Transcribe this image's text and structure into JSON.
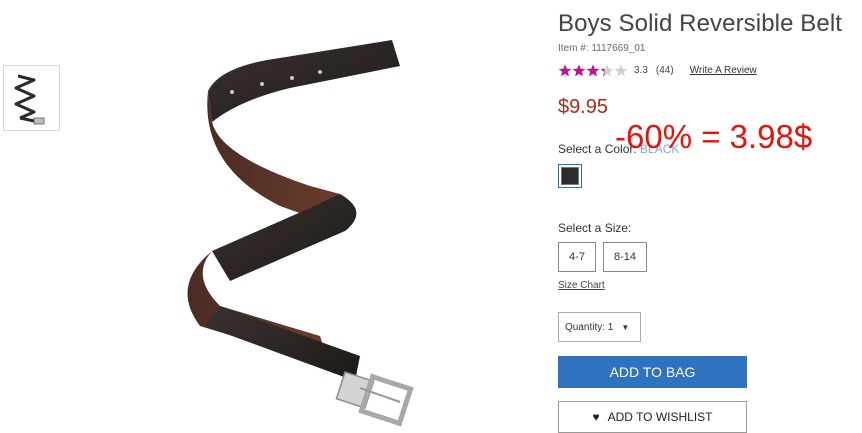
{
  "thumbnail": {
    "icon": "belt-thumbnail"
  },
  "product_image": {
    "icon": "belt-image"
  },
  "product": {
    "title": "Boys Solid Reversible Belt",
    "item_number": "Item #: 1117669_01",
    "rating": 3.3,
    "rating_text": "3.3",
    "review_count": "(44)",
    "write_review": "Write A Review",
    "price": "$9.95"
  },
  "promo_overlay": "-60% = 3.98$",
  "color": {
    "label": "Select a Color:",
    "value": "BLACK",
    "swatch_color": "#2c2c2f"
  },
  "size": {
    "label": "Select a Size:",
    "options": [
      "4-7",
      "8-14"
    ],
    "chart_link": "Size Chart"
  },
  "quantity": {
    "label": "Quantity: 1",
    "caret": "▼"
  },
  "actions": {
    "add_to_bag": "ADD TO BAG",
    "add_to_wishlist": "ADD TO WISHLIST",
    "heart": "♥"
  },
  "colors": {
    "price": "#b3261e",
    "promo": "#e8120c",
    "primary_button": "#2f73c0",
    "star_filled": "#c0148c",
    "star_empty": "#d0d0d0"
  }
}
